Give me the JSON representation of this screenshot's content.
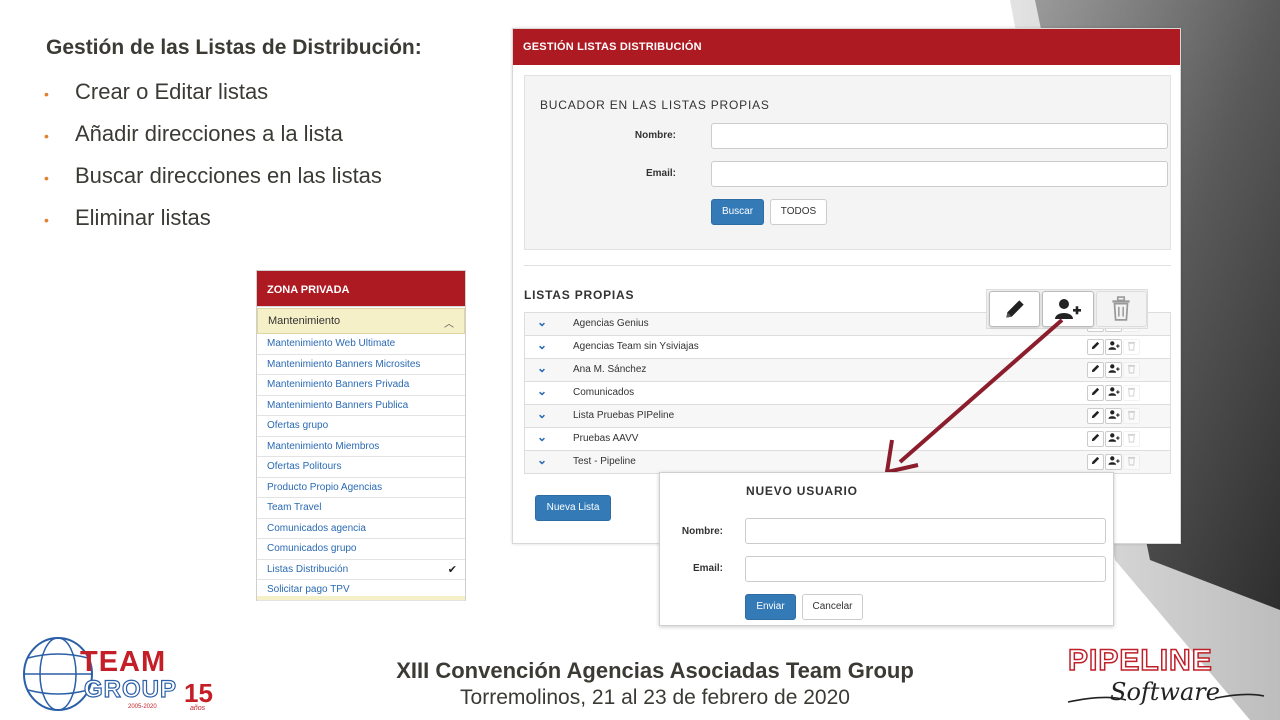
{
  "slide": {
    "title": "Gestión de las Listas de Distribución:",
    "bullets": [
      "Crear o Editar listas",
      "Añadir direcciones a la lista",
      "Buscar direcciones en las listas",
      "Eliminar listas"
    ]
  },
  "main_panel": {
    "header": "GESTIÓN LISTAS DISTRIBUCIÓN",
    "search": {
      "title": "BUCADOR EN LAS LISTAS PROPIAS",
      "name_label": "Nombre:",
      "name_value": "",
      "email_label": "Email:",
      "email_value": "",
      "search_button": "Buscar",
      "all_button": "TODOS"
    },
    "lists_title": "LISTAS PROPIAS",
    "lists": [
      "Agencias Genius",
      "Agencias Team sin Ysiviajas",
      "Ana M. Sánchez",
      "Comunicados",
      "Lista Pruebas PIPeline",
      "Pruebas AAVV",
      "Test - Pipeline"
    ],
    "new_list_button": "Nueva Lista",
    "row_action_icons": [
      "pencil-icon",
      "add-user-icon",
      "trash-icon"
    ]
  },
  "new_user_panel": {
    "title": "NUEVO USUARIO",
    "name_label": "Nombre:",
    "name_value": "",
    "email_label": "Email:",
    "email_value": "",
    "send_button": "Enviar",
    "cancel_button": "Cancelar"
  },
  "sidebar": {
    "header": "ZONA PRIVADA",
    "section": "Mantenimiento",
    "items": [
      "Mantenimiento Web Ultimate",
      "Mantenimiento Banners Microsites",
      "Mantenimiento Banners Privada",
      "Mantenimiento Banners Publica",
      "Ofertas grupo",
      "Mantenimiento Miembros",
      "Ofertas Politours",
      "Producto Propio Agencias",
      "Team Travel",
      "Comunicados agencia",
      "Comunicados grupo",
      "Listas Distribución",
      "Solicitar pago TPV"
    ],
    "active_item": "Listas Distribución"
  },
  "footer": {
    "title": "XIII Convención  Agencias Asociadas Team Group",
    "subtitle": "Torremolinos, 21 al 23 de febrero de 2020"
  },
  "logos": {
    "team": {
      "word1": "TEAM",
      "word2": "GROUP",
      "number": "15",
      "years": "2005-2020",
      "anos": "años"
    },
    "pipeline": {
      "name": "PIPELINE",
      "sub": "Software"
    }
  },
  "colors": {
    "brand_red": "#ae1a22",
    "primary_blue": "#337ab7",
    "link_blue": "#2a6ab3",
    "accent_orange": "#e0812e",
    "arrow": "#8b1d2c"
  }
}
